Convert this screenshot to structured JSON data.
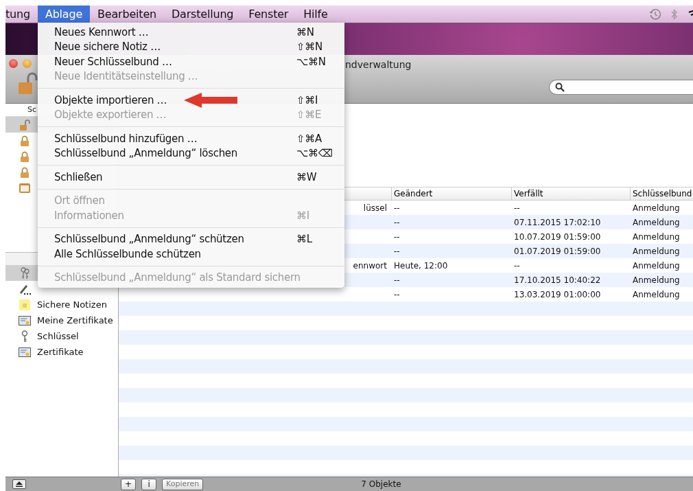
{
  "menu_bar": {
    "items": [
      {
        "label": "tung",
        "selected": false
      },
      {
        "label": "Ablage",
        "selected": true
      },
      {
        "label": "Bearbeiten",
        "selected": false
      },
      {
        "label": "Darstellung",
        "selected": false
      },
      {
        "label": "Fenster",
        "selected": false
      },
      {
        "label": "Hilfe",
        "selected": false
      }
    ]
  },
  "menu": {
    "groups": [
      [
        {
          "label": "Neues Kennwort …",
          "shortcut": "⌘N",
          "disabled": false
        },
        {
          "label": "Neue sichere Notiz …",
          "shortcut": "⇧⌘N",
          "disabled": false
        },
        {
          "label": "Neuer Schlüsselbund …",
          "shortcut": "⌥⌘N",
          "disabled": false
        },
        {
          "label": "Neue Identitätseinstellung …",
          "disabled": true
        }
      ],
      [
        {
          "label": "Objekte importieren …",
          "shortcut": "⇧⌘I",
          "disabled": false,
          "arrow": true
        },
        {
          "label": "Objekte exportieren …",
          "shortcut": "⇧⌘E",
          "disabled": true
        }
      ],
      [
        {
          "label": "Schlüsselbund hinzufügen …",
          "shortcut": "⇧⌘A",
          "disabled": false
        },
        {
          "label": "Schlüsselbund „Anmeldung“ löschen",
          "shortcut": "⌥⌘⌫",
          "disabled": false
        }
      ],
      [
        {
          "label": "Schließen",
          "shortcut": "⌘W",
          "disabled": false
        }
      ],
      [
        {
          "label": "Ort öffnen",
          "disabled": true
        },
        {
          "label": "Informationen",
          "shortcut": "⌘I",
          "disabled": true
        }
      ],
      [
        {
          "label": "Schlüsselbund „Anmeldung“ schützen",
          "shortcut": "⌘L",
          "disabled": false
        },
        {
          "label": "Alle Schlüsselbunde schützen",
          "disabled": false
        }
      ],
      [
        {
          "label": "Schlüsselbund „Anmeldung“ als Standard sichern",
          "disabled": true
        }
      ]
    ]
  },
  "window": {
    "title": "ndverwaltung"
  },
  "sidebar": {
    "header": "Sc",
    "keychains": [
      {
        "kind": "unlocked",
        "selected": true
      },
      {
        "kind": "lock",
        "selected": false
      },
      {
        "kind": "lock",
        "selected": false
      },
      {
        "kind": "lock",
        "selected": false
      },
      {
        "kind": "folder",
        "selected": false
      }
    ],
    "categories": [
      {
        "kind": "keys",
        "selected": true
      },
      {
        "kind": "pencil",
        "selected": false
      },
      {
        "kind": "note",
        "label": "Sichere Notizen",
        "selected": false
      },
      {
        "kind": "cert",
        "label": "Meine Zertifikate",
        "selected": false
      },
      {
        "kind": "key",
        "label": "Schlüssel",
        "selected": false
      },
      {
        "kind": "cert",
        "label": "Zertifikate",
        "selected": false
      }
    ]
  },
  "table": {
    "columns": [
      {
        "label": "Geändert"
      },
      {
        "label": "Verfällt"
      },
      {
        "label": "Schlüsselbund"
      }
    ],
    "rows": [
      {
        "column_2": "lüssel",
        "changed": "--",
        "expires": "--",
        "keychain": "Anmeldung"
      },
      {
        "changed": "--",
        "expires": "07.11.2015 17:02:10",
        "keychain": "Anmeldung"
      },
      {
        "changed": "--",
        "expires": "10.07.2019 01:59:00",
        "keychain": "Anmeldung"
      },
      {
        "changed": "--",
        "expires": "01.07.2019 01:59:00",
        "keychain": "Anmeldung"
      },
      {
        "column_2": "ennwort",
        "changed": "Heute, 12:00",
        "expires": "--",
        "keychain": "Anmeldung"
      },
      {
        "changed": "--",
        "expires": "17.10.2015 10:40:22",
        "keychain": "Anmeldung"
      },
      {
        "changed": "--",
        "expires": "13.03.2019 01:00:00",
        "keychain": "Anmeldung"
      }
    ]
  },
  "status_bar": {
    "buttons": [
      {
        "label": "+",
        "disabled": false
      },
      {
        "label": "i",
        "disabled": false
      },
      {
        "label": "Kopieren",
        "disabled": true
      }
    ],
    "count": "7 Objekte"
  }
}
